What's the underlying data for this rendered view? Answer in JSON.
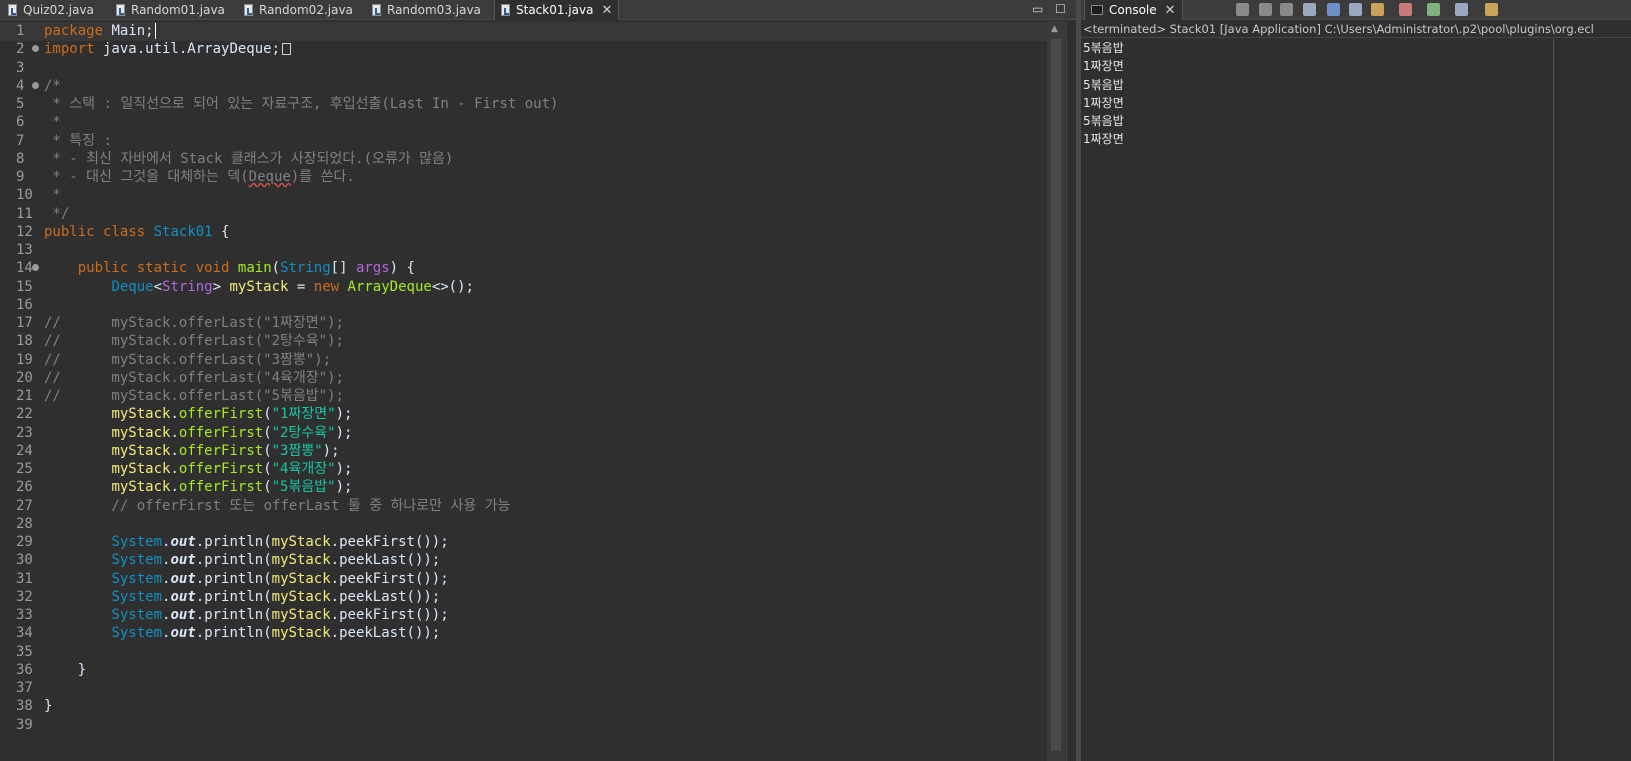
{
  "editor": {
    "tabs": [
      {
        "label": "Quiz02.java",
        "active": false
      },
      {
        "label": "Random01.java",
        "active": false
      },
      {
        "label": "Random02.java",
        "active": false
      },
      {
        "label": "Random03.java",
        "active": false
      },
      {
        "label": "Stack01.java",
        "active": true
      }
    ],
    "close_glyph": "✕",
    "minimize_glyph": "▭",
    "maximize_glyph": "☐",
    "line_numbers": [
      "1",
      "2",
      "3",
      "4",
      "5",
      "6",
      "7",
      "8",
      "9",
      "10",
      "11",
      "12",
      "13",
      "14",
      "15",
      "16",
      "17",
      "18",
      "19",
      "20",
      "21",
      "22",
      "23",
      "24",
      "25",
      "26",
      "27",
      "28",
      "29",
      "30",
      "31",
      "32",
      "33",
      "34",
      "35",
      "36",
      "37",
      "38",
      "39"
    ],
    "code": {
      "l1": [
        "package",
        " Main;"
      ],
      "l2": [
        "import",
        " java.util.ArrayDeque;"
      ],
      "l4": "/*",
      "l5": " * 스택 : 일직선으로 되어 있는 자료구조, 후입선출(Last In - First out)",
      "l6": " *",
      "l7": " * 특징 :",
      "l8": " * - 최신 자바에서 Stack 클래스가 사장되었다.(오류가 많음)",
      "l9": [
        " * - 대신 그것을 대체하는 덱(",
        "Deque",
        ")를 쓴다."
      ],
      "l10": " *",
      "l11": " */",
      "l12": [
        "public",
        " ",
        "class",
        " ",
        "Stack01",
        " {"
      ],
      "l14": [
        "    ",
        "public",
        " ",
        "static",
        " ",
        "void",
        " ",
        "main",
        "(",
        "String",
        "[] ",
        "args",
        ") {"
      ],
      "l15": [
        "        ",
        "Deque",
        "<",
        "String",
        "> ",
        "myStack",
        " = ",
        "new",
        " ",
        "ArrayDeque",
        "<>();"
      ],
      "l17": [
        "//",
        "      myStack.offerLast(\"1짜장면\");"
      ],
      "l18": [
        "//",
        "      myStack.offerLast(\"2탕수육\");"
      ],
      "l19": [
        "//",
        "      myStack.offerLast(\"3짬뽕\");"
      ],
      "l20": [
        "//",
        "      myStack.offerLast(\"4육개장\");"
      ],
      "l21": [
        "//",
        "      myStack.offerLast(\"5볶음밥\");"
      ],
      "offer_first_args": [
        "\"1짜장면\"",
        "\"2탕수육\"",
        "\"3짬뽕\"",
        "\"4육개장\"",
        "\"5볶음밥\""
      ],
      "l27": "        // offerFirst 또는 offerLast 둘 중 하나로만 사용 가능",
      "println_calls": [
        "peekFirst",
        "peekLast",
        "peekFirst",
        "peekLast",
        "peekFirst",
        "peekLast"
      ],
      "l36": "    }",
      "l38": "}"
    }
  },
  "console": {
    "tab_label": "Console",
    "status": "<terminated> Stack01 [Java Application] C:\\Users\\Administrator\\.p2\\pool\\plugins\\org.ecl",
    "output": [
      "5볶음밥",
      "1짜장면",
      "5볶음밥",
      "1짜장면",
      "5볶음밥",
      "1짜장면"
    ],
    "toolbar_icons": [
      "terminate-icon",
      "remove-launch-icon",
      "remove-all-icon",
      "clear-console-icon",
      "scroll-lock-icon",
      "word-wrap-icon",
      "show-on-output-icon",
      "show-on-error-icon",
      "pin-console-icon",
      "display-console-icon",
      "open-console-icon"
    ]
  },
  "colors": {
    "background": "#2f2f2f",
    "keyword": "#cc6c1d",
    "type": "#1290c3",
    "string": "#17c6a3",
    "comment": "#808080",
    "field": "#f3ec79",
    "method": "#a7ec21",
    "generic": "#b166da"
  }
}
